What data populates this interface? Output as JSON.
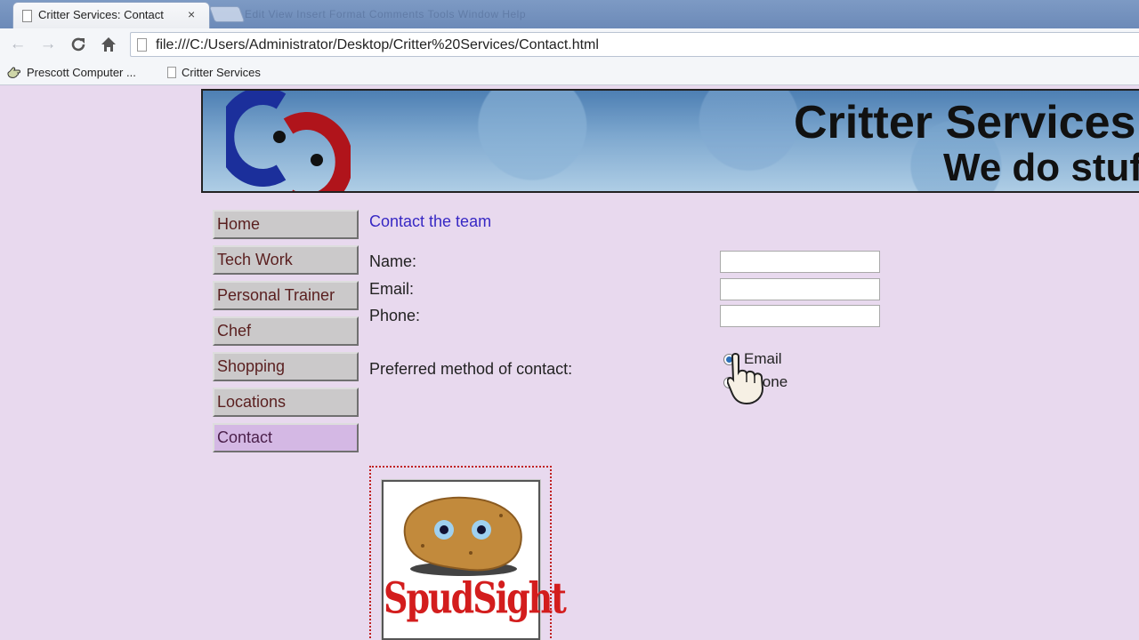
{
  "browser": {
    "tab_title": "Critter Services: Contact",
    "tab_close": "×",
    "ghost_menu": "Edit   View   Insert   Format   Comments   Tools   Window   Help",
    "url": "file:///C:/Users/Administrator/Desktop/Critter%20Services/Contact.html",
    "bookmarks": [
      "Prescott Computer ...",
      "Critter Services"
    ]
  },
  "banner": {
    "title": "Critter Services",
    "tagline": "We do stuff"
  },
  "nav": {
    "items": [
      "Home",
      "Tech Work",
      "Personal Trainer",
      "Chef",
      "Shopping",
      "Locations",
      "Contact"
    ],
    "active": "Contact"
  },
  "form": {
    "heading": "Contact the team",
    "name_label": "Name:",
    "email_label": "Email:",
    "phone_label": "Phone:",
    "name_value": "",
    "email_value": "",
    "phone_value": "",
    "preferred_label": "Preferred method of contact:",
    "options": [
      "Email",
      "Phone"
    ],
    "selected": "Email"
  },
  "ad": {
    "text": "SpudSight"
  },
  "colors": {
    "page_bg": "#e8d9ee",
    "heading": "#3728c4",
    "nav_text": "#5a1f1f",
    "nav_active_bg": "#d4b8e4",
    "ad_text": "#d31d1d"
  }
}
